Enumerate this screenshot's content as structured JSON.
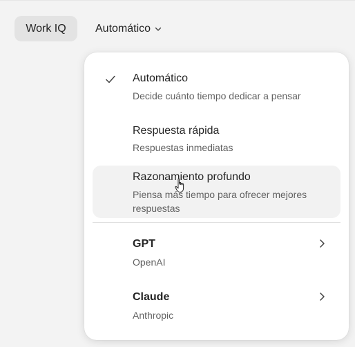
{
  "topbar": {
    "chip_label": "Work IQ",
    "mode_label": "Automático"
  },
  "menu": {
    "items": [
      {
        "title": "Automático",
        "subtitle": "Decide cuánto tiempo dedicar a pensar",
        "selected": true
      },
      {
        "title": "Respuesta rápida",
        "subtitle": "Respuestas inmediatas",
        "selected": false
      },
      {
        "title": "Razonamiento profundo",
        "subtitle": "Piensa más tiempo para ofrecer mejores respuestas",
        "selected": false,
        "hovered": true
      }
    ],
    "models": [
      {
        "title": "GPT",
        "subtitle": "OpenAI",
        "has_submenu": true
      },
      {
        "title": "Claude",
        "subtitle": "Anthropic",
        "has_submenu": true
      }
    ]
  },
  "icons": {
    "check": "checkmark-icon",
    "chevron_down": "chevron-down-icon",
    "chevron_right": "chevron-right-icon",
    "cursor": "hand-pointer-icon"
  }
}
